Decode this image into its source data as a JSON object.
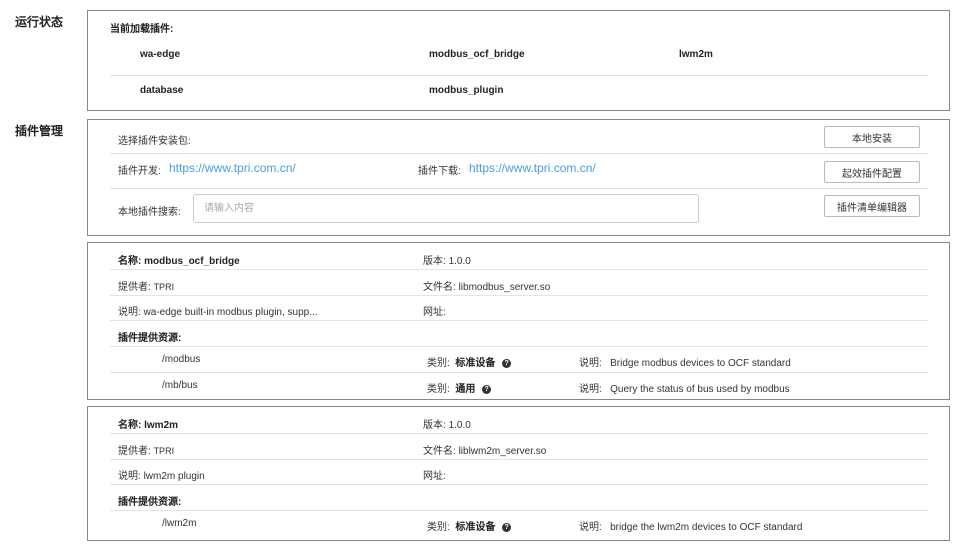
{
  "running_status": {
    "label": "运行状态",
    "loaded_title": "当前加载插件:",
    "plugins": [
      "wa-edge",
      "modbus_ocf_bridge",
      "lwm2m",
      "database",
      "modbus_plugin"
    ]
  },
  "plugin_mgmt": {
    "label": "插件管理",
    "select_package_label": "选择插件安装包:",
    "install_local_button": "本地安装",
    "dev_label": "插件开发:",
    "dev_url": "https://www.tpri.com.cn/",
    "download_label": "插件下载:",
    "download_url": "https://www.tpri.com.cn/",
    "activate_config_button": "起效插件配置",
    "search_label": "本地插件搜索:",
    "search_placeholder": "请输入内容",
    "list_editor_button": "插件清单编辑器"
  },
  "plugin_cards": [
    {
      "name_label": "名称:",
      "name": "modbus_ocf_bridge",
      "version_label": "版本:",
      "version": "1.0.0",
      "provider_label": "提供者:",
      "provider": "TPRI",
      "file_label": "文件名:",
      "file": "libmodbus_server.so",
      "desc_label": "说明:",
      "desc": "wa-edge built-in modbus plugin, supp...",
      "url_label": "网址:",
      "resources_title": "插件提供资源:",
      "resources": [
        {
          "path": "/modbus",
          "type_label": "类别:",
          "type": "标准设备",
          "desc_label": "说明:",
          "desc": "Bridge modbus devices to OCF standard"
        },
        {
          "path": "/mb/bus",
          "type_label": "类别:",
          "type": "通用",
          "desc_label": "说明:",
          "desc": "Query the status of bus used by modbus"
        }
      ]
    },
    {
      "name_label": "名称:",
      "name": "lwm2m",
      "version_label": "版本:",
      "version": "1.0.0",
      "provider_label": "提供者:",
      "provider": "TPRI",
      "file_label": "文件名:",
      "file": "liblwm2m_server.so",
      "desc_label": "说明:",
      "desc": "lwm2m plugin",
      "url_label": "网址:",
      "resources_title": "插件提供资源:",
      "resources": [
        {
          "path": "/lwm2m",
          "type_label": "类别:",
          "type": "标准设备",
          "desc_label": "说明:",
          "desc": "bridge the lwm2m devices to OCF standard"
        }
      ]
    }
  ],
  "help_icon_glyph": "?"
}
